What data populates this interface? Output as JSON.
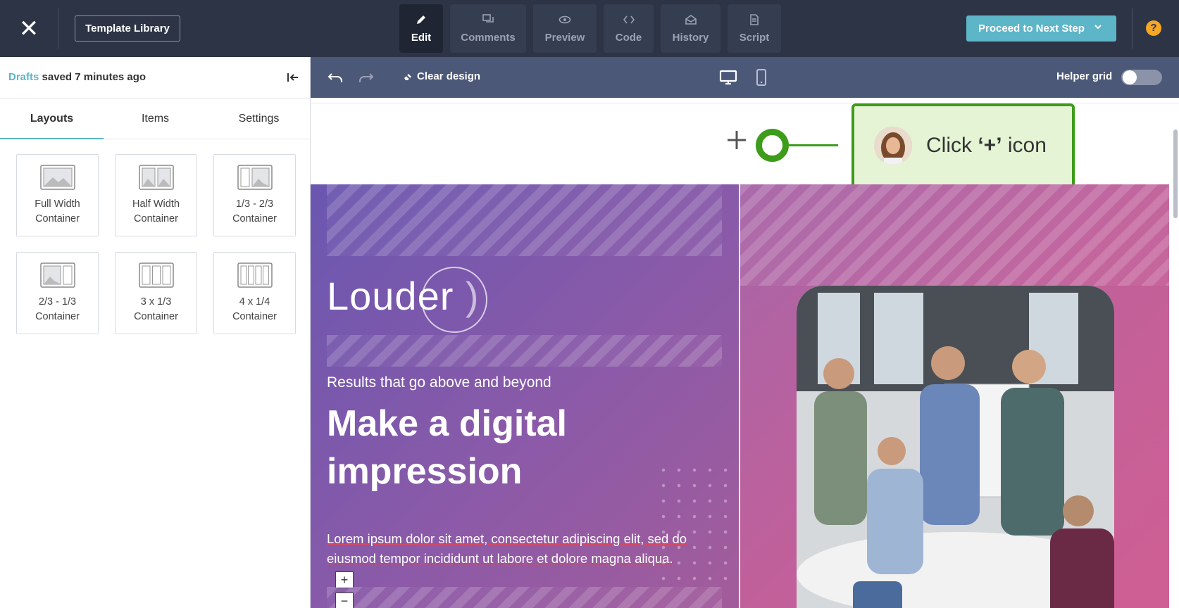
{
  "topbar": {
    "template_library": "Template Library",
    "tabs": [
      {
        "label": "Edit",
        "icon": "pencil-icon",
        "active": true
      },
      {
        "label": "Comments",
        "icon": "comments-icon",
        "active": false
      },
      {
        "label": "Preview",
        "icon": "eye-icon",
        "active": false
      },
      {
        "label": "Code",
        "icon": "code-icon",
        "active": false
      },
      {
        "label": "History",
        "icon": "history-icon",
        "active": false
      },
      {
        "label": "Script",
        "icon": "script-icon",
        "active": false
      }
    ],
    "proceed": "Proceed to Next Step",
    "help": "?"
  },
  "status": {
    "drafts_link": "Drafts",
    "saved_text": "saved 7 minutes ago"
  },
  "panel": {
    "tabs": [
      "Layouts",
      "Items",
      "Settings"
    ],
    "layouts": [
      {
        "line1": "Full Width",
        "line2": "Container"
      },
      {
        "line1": "Half Width",
        "line2": "Container"
      },
      {
        "line1": "1/3 - 2/3",
        "line2": "Container"
      },
      {
        "line1": "2/3 - 1/3",
        "line2": "Container"
      },
      {
        "line1": "3 x 1/3",
        "line2": "Container"
      },
      {
        "line1": "4 x 1/4",
        "line2": "Container"
      }
    ]
  },
  "toolbar": {
    "clear_design": "Clear design",
    "helper_grid": "Helper grid"
  },
  "callout": {
    "prefix": "Click ",
    "key": "‘+’",
    "suffix": " icon"
  },
  "hero": {
    "logo": "Louder",
    "subtitle": "Results that go above and beyond",
    "headline": "Make a digital impression",
    "body": "Lorem ipsum dolor sit amet, consectetur adipiscing elit, sed do eiusmod tempor incididunt ut labore et dolore magna aliqua.",
    "plus": "+",
    "minus": "−"
  },
  "colors": {
    "topbar": "#2d3446",
    "accent": "#5db5c8",
    "callout_green": "#3d9c1a",
    "callout_bg": "#e4f4d4",
    "canvas_toolbar": "#4b5878"
  }
}
